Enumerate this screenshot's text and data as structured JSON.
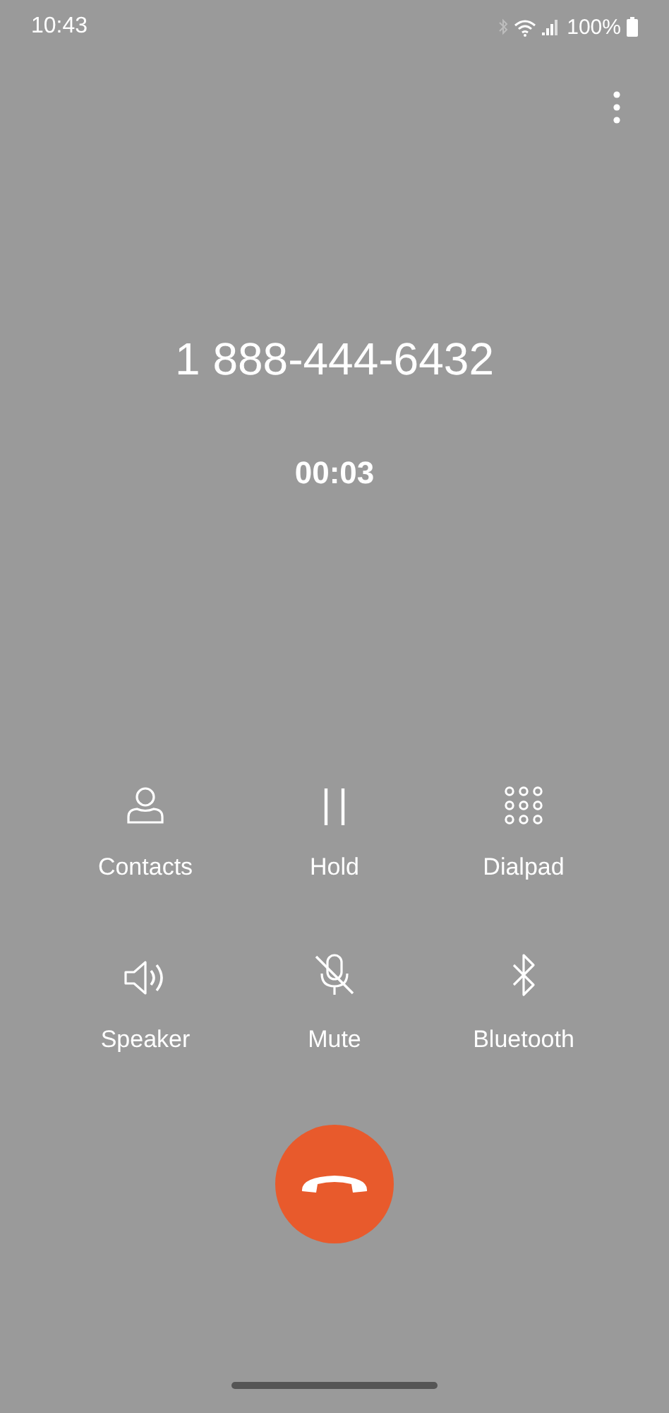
{
  "status_bar": {
    "time": "10:43",
    "battery": "100%"
  },
  "call": {
    "number": "1 888-444-6432",
    "duration": "00:03"
  },
  "actions": [
    {
      "kind": "contacts",
      "label": "Contacts"
    },
    {
      "kind": "hold",
      "label": "Hold"
    },
    {
      "kind": "dialpad",
      "label": "Dialpad"
    },
    {
      "kind": "speaker",
      "label": "Speaker"
    },
    {
      "kind": "mute",
      "label": "Mute"
    },
    {
      "kind": "bluetooth",
      "label": "Bluetooth"
    }
  ]
}
